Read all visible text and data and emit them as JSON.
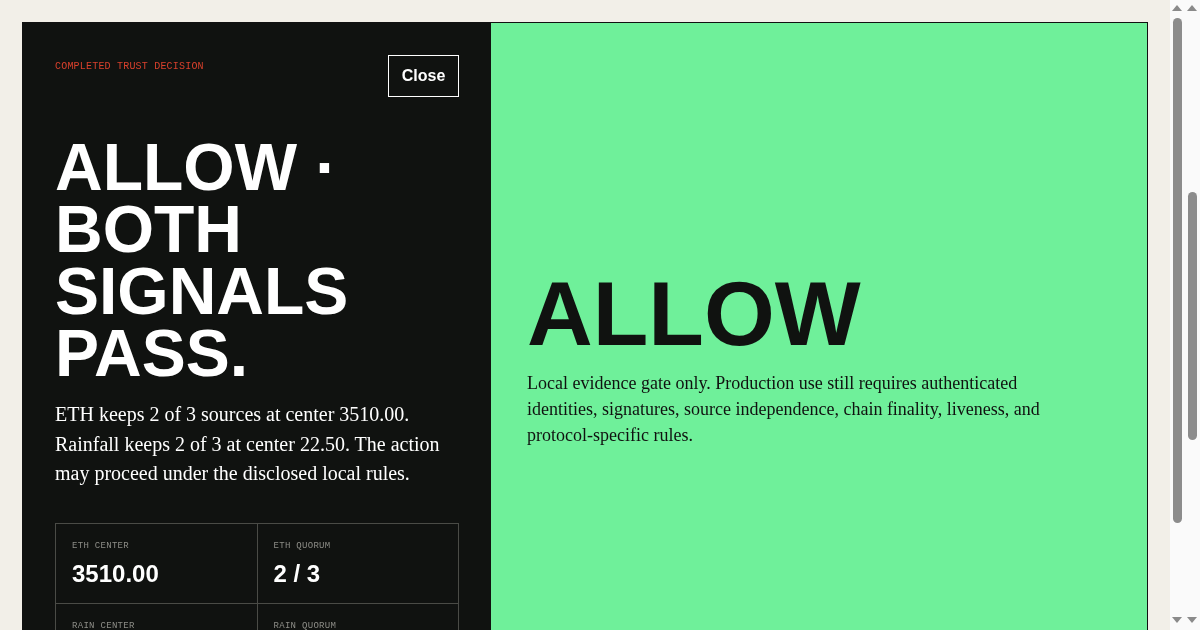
{
  "decision_panel": {
    "eyebrow": "COMPLETED TRUST DECISION",
    "close_button": "Close",
    "headline": "ALLOW · BOTH SIGNALS PASS.",
    "summary": "ETH keeps 2 of 3 sources at center 3510.00. Rainfall keeps 2 of 3 at center 22.50. The action may proceed under the disclosed local rules.",
    "stats": [
      {
        "label": "ETH CENTER",
        "value": "3510.00"
      },
      {
        "label": "ETH QUORUM",
        "value": "2 / 3"
      },
      {
        "label": "RAIN CENTER"
      },
      {
        "label": "RAIN QUORUM"
      }
    ]
  },
  "verdict_panel": {
    "verdict": "ALLOW",
    "note": "Local evidence gate only. Production use still requires authenticated identities, signatures, source independence, chain finality, liveness, and protocol-specific rules."
  }
}
